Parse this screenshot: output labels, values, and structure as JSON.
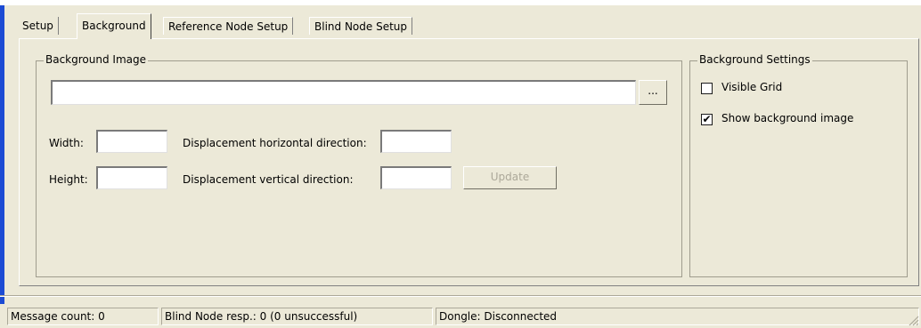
{
  "tabs": [
    {
      "label": "Setup",
      "active": false
    },
    {
      "label": "Background",
      "active": true
    },
    {
      "label": "Reference Node Setup",
      "active": false
    },
    {
      "label": "Blind Node Setup",
      "active": false
    }
  ],
  "background_image": {
    "legend": "Background Image",
    "path_value": "",
    "browse_label": "...",
    "width_label": "Width:",
    "width_value": "",
    "height_label": "Height:",
    "height_value": "",
    "disp_h_label": "Displacement horizontal direction:",
    "disp_h_value": "",
    "disp_v_label": "Displacement vertical direction:",
    "disp_v_value": "",
    "update_label": "Update"
  },
  "background_settings": {
    "legend": "Background Settings",
    "visible_grid_label": "Visible Grid",
    "visible_grid_checked": false,
    "show_image_label": "Show background image",
    "show_image_checked": true,
    "checkmark": "✔"
  },
  "statusbar": {
    "message_count": "Message count: 0",
    "blind_node_resp": "Blind Node resp.: 0 (0 unsuccessful)",
    "dongle": "Dongle: Disconnected"
  },
  "colors": {
    "window_bg": "#ece9d8",
    "accent_bar": "#1c4bd4"
  }
}
